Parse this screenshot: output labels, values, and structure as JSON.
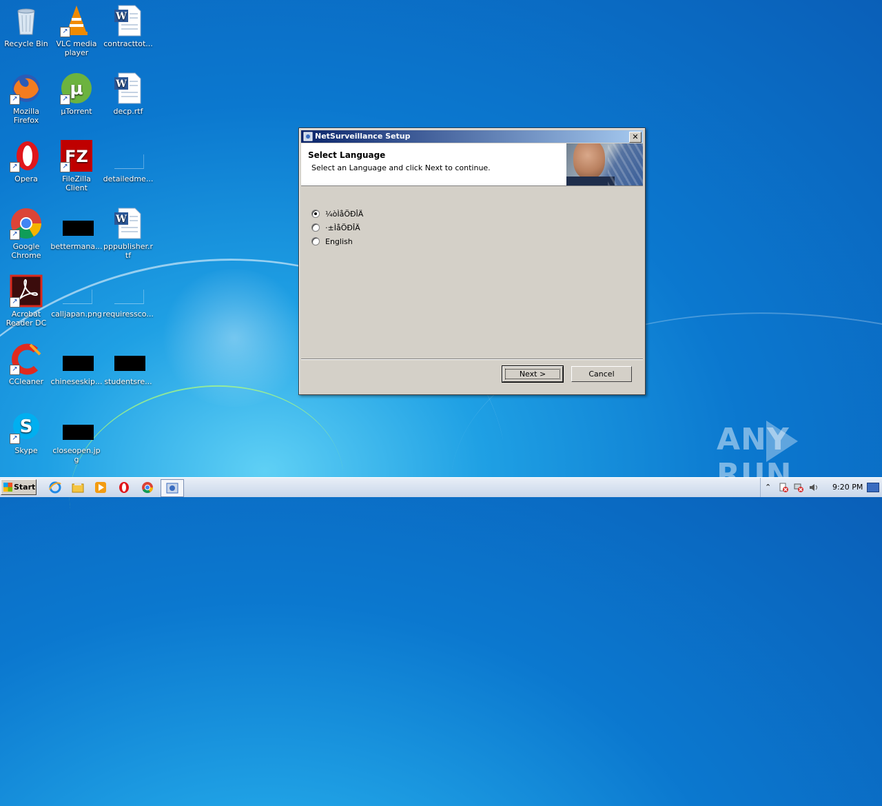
{
  "desktop": {
    "icons": [
      {
        "label": "Recycle Bin",
        "icon": "recycle-bin-icon"
      },
      {
        "label": "VLC media player",
        "icon": "vlc-icon"
      },
      {
        "label": "contracttot...",
        "icon": "word-doc-icon"
      },
      {
        "label": "Mozilla Firefox",
        "icon": "firefox-icon"
      },
      {
        "label": "µTorrent",
        "icon": "utorrent-icon"
      },
      {
        "label": "decp.rtf",
        "icon": "word-doc-icon"
      },
      {
        "label": "Opera",
        "icon": "opera-icon"
      },
      {
        "label": "FileZilla Client",
        "icon": "filezilla-icon"
      },
      {
        "label": "detailedme...",
        "icon": "blank-file-icon"
      },
      {
        "label": "Google Chrome",
        "icon": "chrome-icon"
      },
      {
        "label": "bettermana...",
        "icon": "black-thumbnail-icon"
      },
      {
        "label": "pppublisher.rtf",
        "icon": "word-doc-icon"
      },
      {
        "label": "Acrobat Reader DC",
        "icon": "acrobat-icon"
      },
      {
        "label": "calljapan.png",
        "icon": "blank-file-icon"
      },
      {
        "label": "requiressco...",
        "icon": "blank-file-icon"
      },
      {
        "label": "CCleaner",
        "icon": "ccleaner-icon"
      },
      {
        "label": "chineseskip...",
        "icon": "black-thumbnail-icon"
      },
      {
        "label": "studentsre...",
        "icon": "black-thumbnail-icon"
      },
      {
        "label": "Skype",
        "icon": "skype-icon"
      },
      {
        "label": "closeopen.jpg",
        "icon": "black-thumbnail-icon"
      }
    ]
  },
  "dialog": {
    "title": "NetSurveillance Setup",
    "close_label": "✕",
    "header_title": "Select Language",
    "header_subtitle": "Select an Language and click Next to continue.",
    "languages": [
      {
        "label": "¼òÌåÖÐÎÄ",
        "selected": true
      },
      {
        "label": "·±ÌåÖÐÎÄ",
        "selected": false
      },
      {
        "label": "English",
        "selected": false
      }
    ],
    "next_label": "Next >",
    "cancel_label": "Cancel"
  },
  "watermark": {
    "text_left": "ANY",
    "text_right": "RUN"
  },
  "taskbar": {
    "start_label": "Start",
    "pinned": [
      "ie-icon",
      "explorer-icon",
      "media-player-icon",
      "opera-icon",
      "chrome-icon",
      "setup-icon"
    ],
    "clock": "9:20 PM"
  }
}
